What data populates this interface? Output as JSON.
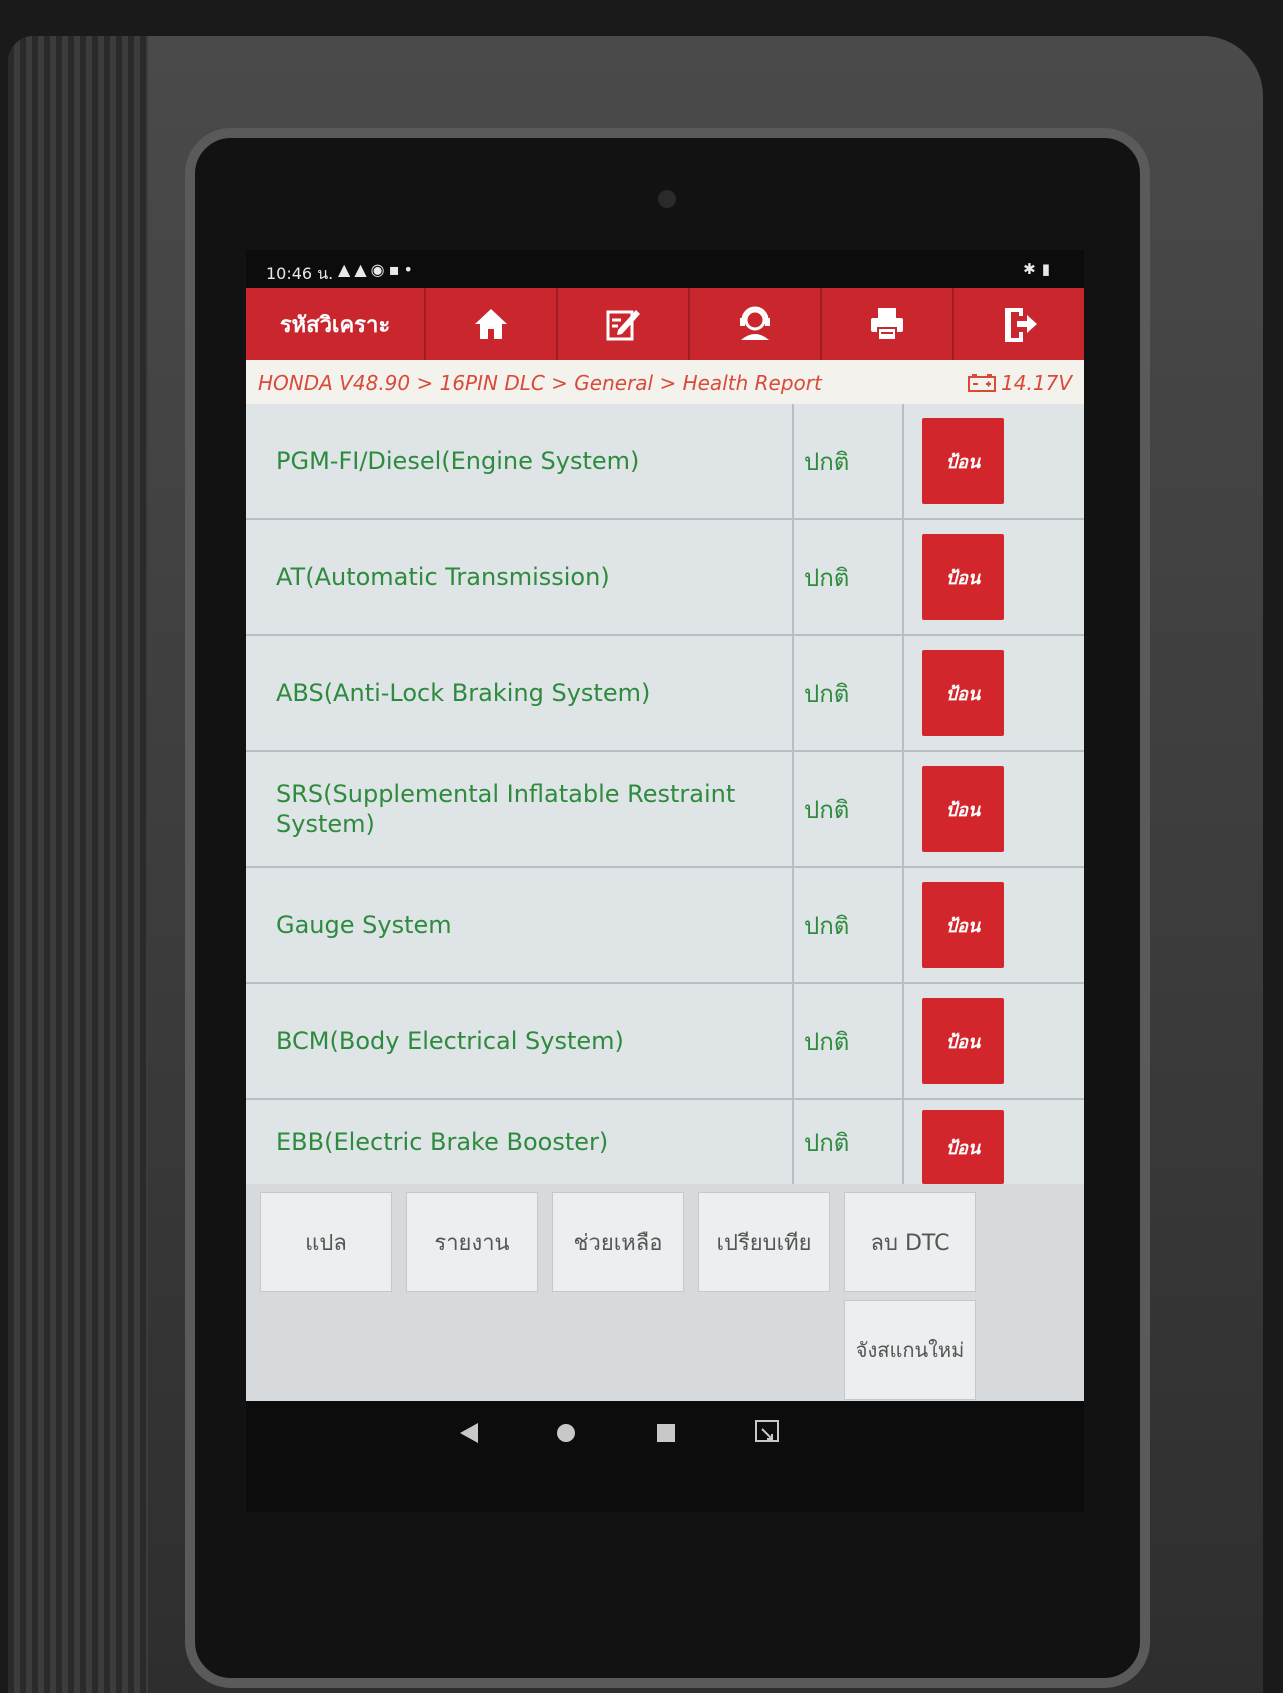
{
  "status_bar": {
    "time": "10:46 น.",
    "icons": [
      "warning-icon",
      "warning-icon",
      "whatsapp-icon",
      "gallery-icon",
      "dot-icon"
    ],
    "right_icons": [
      "bluetooth-icon",
      "battery-icon"
    ]
  },
  "toolbar": {
    "title": "รหัสวิเคราะ",
    "buttons": [
      "home-icon",
      "edit-icon",
      "support-icon",
      "print-icon",
      "exit-icon"
    ],
    "color": "#c9262e"
  },
  "breadcrumb": {
    "path": "HONDA V48.90 > 16PIN DLC > General > Health Report",
    "voltage": "14.17V"
  },
  "systems": [
    {
      "name": "PGM-FI/Diesel(Engine System)",
      "status": "ปกติ",
      "button": "ป้อน"
    },
    {
      "name": "AT(Automatic Transmission)",
      "status": "ปกติ",
      "button": "ป้อน"
    },
    {
      "name": "ABS(Anti-Lock Braking System)",
      "status": "ปกติ",
      "button": "ป้อน"
    },
    {
      "name": "SRS(Supplemental Inflatable Restraint System)",
      "status": "ปกติ",
      "button": "ป้อน"
    },
    {
      "name": "Gauge System",
      "status": "ปกติ",
      "button": "ป้อน"
    },
    {
      "name": "BCM(Body Electrical System)",
      "status": "ปกติ",
      "button": "ป้อน"
    },
    {
      "name": "EBB(Electric Brake Booster)",
      "status": "ปกติ",
      "button": "ป้อน"
    }
  ],
  "actions": {
    "translate": "แปล",
    "report": "รายงาน",
    "help": "ช่วยเหลือ",
    "compare": "เปรียบเทีย",
    "clear_dtc": "ลบ DTC",
    "rescan": "จังสแกนใหม่"
  },
  "colors": {
    "accent": "#c9262e",
    "ok_text": "#2e8b3e",
    "crumb_text": "#d94a3a"
  }
}
